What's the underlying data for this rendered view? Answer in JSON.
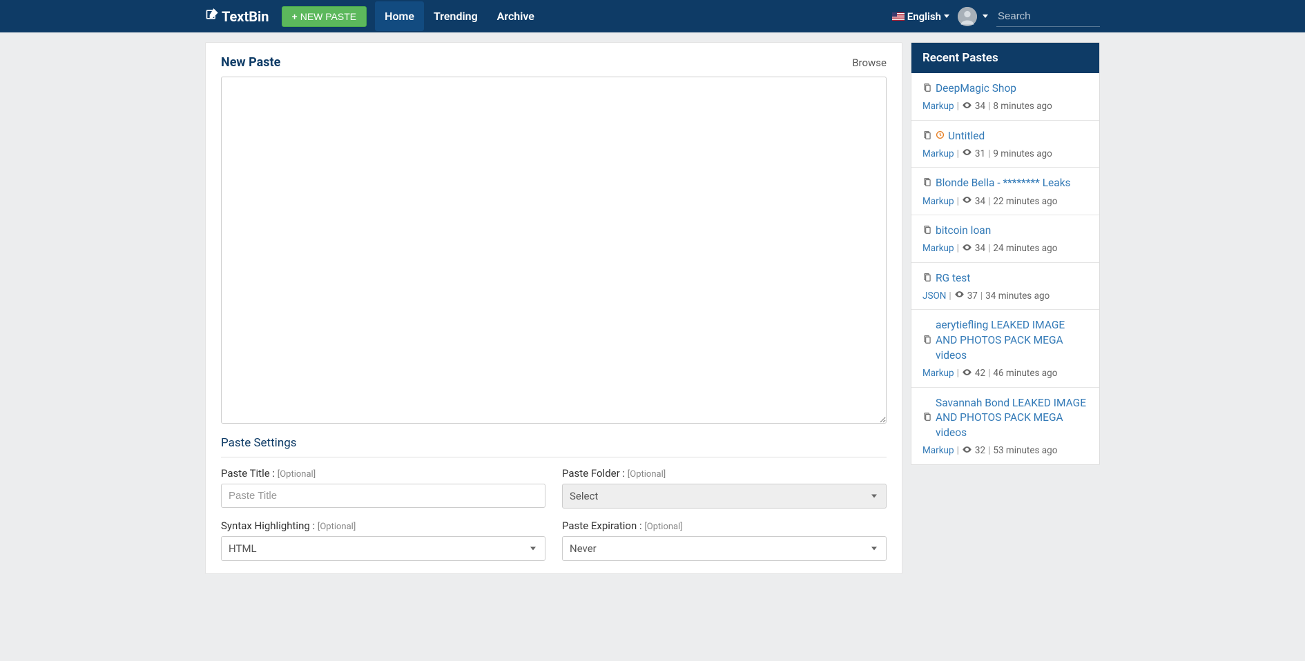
{
  "brand": "TextBin",
  "nav": {
    "new_paste_label": "NEW PASTE",
    "links": [
      {
        "label": "Home",
        "active": true
      },
      {
        "label": "Trending",
        "active": false
      },
      {
        "label": "Archive",
        "active": false
      }
    ],
    "language": "English",
    "search_placeholder": "Search"
  },
  "main": {
    "title": "New Paste",
    "browse": "Browse",
    "paste_value": "",
    "settings_title": "Paste Settings",
    "fields": {
      "title_label": "Paste Title :",
      "title_optional": "[Optional]",
      "title_placeholder": "Paste Title",
      "folder_label": "Paste Folder :",
      "folder_optional": "[Optional]",
      "folder_selected": "Select",
      "syntax_label": "Syntax Highlighting :",
      "syntax_optional": "[Optional]",
      "syntax_selected": "HTML",
      "expiration_label": "Paste Expiration :",
      "expiration_optional": "[Optional]",
      "expiration_selected": "Never"
    }
  },
  "sidebar": {
    "title": "Recent Pastes",
    "items": [
      {
        "title": "DeepMagic Shop",
        "lang": "Markup",
        "views": "34",
        "time": "8 minutes ago",
        "clock": false
      },
      {
        "title": "Untitled",
        "lang": "Markup",
        "views": "31",
        "time": "9 minutes ago",
        "clock": true
      },
      {
        "title": "Blonde Bella - ******** Leaks",
        "lang": "Markup",
        "views": "34",
        "time": "22 minutes ago",
        "clock": false
      },
      {
        "title": "bitcoin loan",
        "lang": "Markup",
        "views": "34",
        "time": "24 minutes ago",
        "clock": false
      },
      {
        "title": "RG test",
        "lang": "JSON",
        "views": "37",
        "time": "34 minutes ago",
        "clock": false
      },
      {
        "title": "aerytiefling LEAKED IMAGE AND PHOTOS PACK MEGA videos",
        "lang": "Markup",
        "views": "42",
        "time": "46 minutes ago",
        "clock": false
      },
      {
        "title": "Savannah Bond LEAKED IMAGE AND PHOTOS PACK MEGA videos",
        "lang": "Markup",
        "views": "32",
        "time": "53 minutes ago",
        "clock": false
      }
    ]
  }
}
